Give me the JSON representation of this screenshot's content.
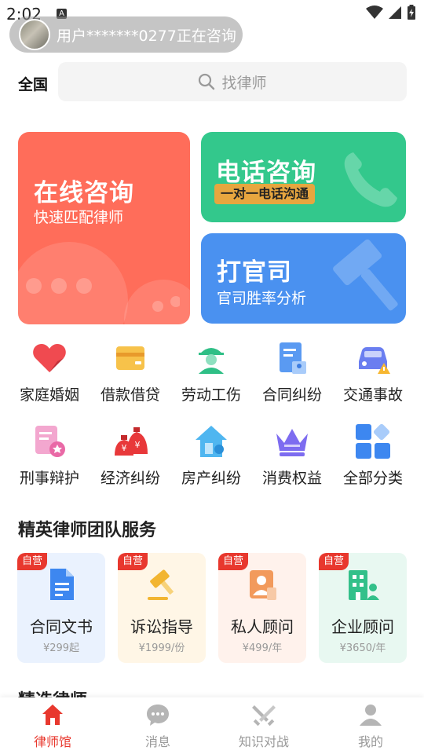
{
  "status_bar": {
    "time": "2:02",
    "notice_letter": "A"
  },
  "consult_toast": {
    "text": "用户*******0277正在咨询"
  },
  "search": {
    "region": "全国",
    "placeholder": "找律师"
  },
  "cards": {
    "online": {
      "title": "在线咨询",
      "subtitle": "快速匹配律师"
    },
    "phone": {
      "title": "电话咨询",
      "badge": "一对一电话沟通"
    },
    "lawsuit": {
      "title": "打官司",
      "subtitle": "官司胜率分析"
    }
  },
  "categories": [
    {
      "label": "家庭婚姻",
      "icon": "heart-icon"
    },
    {
      "label": "借款借贷",
      "icon": "wallet-icon"
    },
    {
      "label": "劳动工伤",
      "icon": "worker-icon"
    },
    {
      "label": "合同纠纷",
      "icon": "contract-icon"
    },
    {
      "label": "交通事故",
      "icon": "car-icon"
    },
    {
      "label": "刑事辩护",
      "icon": "shield-document-icon"
    },
    {
      "label": "经济纠纷",
      "icon": "money-bags-icon"
    },
    {
      "label": "房产纠纷",
      "icon": "house-icon"
    },
    {
      "label": "消费权益",
      "icon": "crown-icon"
    },
    {
      "label": "全部分类",
      "icon": "grid-icon"
    }
  ],
  "elite_section": {
    "title": "精英律师团队服务"
  },
  "services": [
    {
      "badge": "自营",
      "label": "合同文书",
      "price": "¥299起",
      "icon": "document-icon",
      "bg": "#eaf2fe",
      "color": "#3d87f0"
    },
    {
      "badge": "自营",
      "label": "诉讼指导",
      "price": "¥1999/份",
      "icon": "gavel-icon",
      "bg": "#fff6e6",
      "color": "#f2b531"
    },
    {
      "badge": "自营",
      "label": "私人顾问",
      "price": "¥499/年",
      "icon": "person-card-icon",
      "bg": "#fff2ec",
      "color": "#f29a5c"
    },
    {
      "badge": "自营",
      "label": "企业顾问",
      "price": "¥3650/年",
      "icon": "building-icon",
      "bg": "#e8f8f1",
      "color": "#33c08a"
    }
  ],
  "next_section": {
    "title": "精选律师"
  },
  "bottom_nav": [
    {
      "label": "律师馆",
      "icon": "home-icon",
      "active": true
    },
    {
      "label": "消息",
      "icon": "chat-icon",
      "active": false
    },
    {
      "label": "知识对战",
      "icon": "swords-icon",
      "active": false
    },
    {
      "label": "我的",
      "icon": "user-icon",
      "active": false
    }
  ],
  "colors": {
    "accent": "#e8382e",
    "online_card": "#ff6d5a",
    "phone_card": "#33c88c",
    "lawsuit_card": "#4a91f0"
  }
}
